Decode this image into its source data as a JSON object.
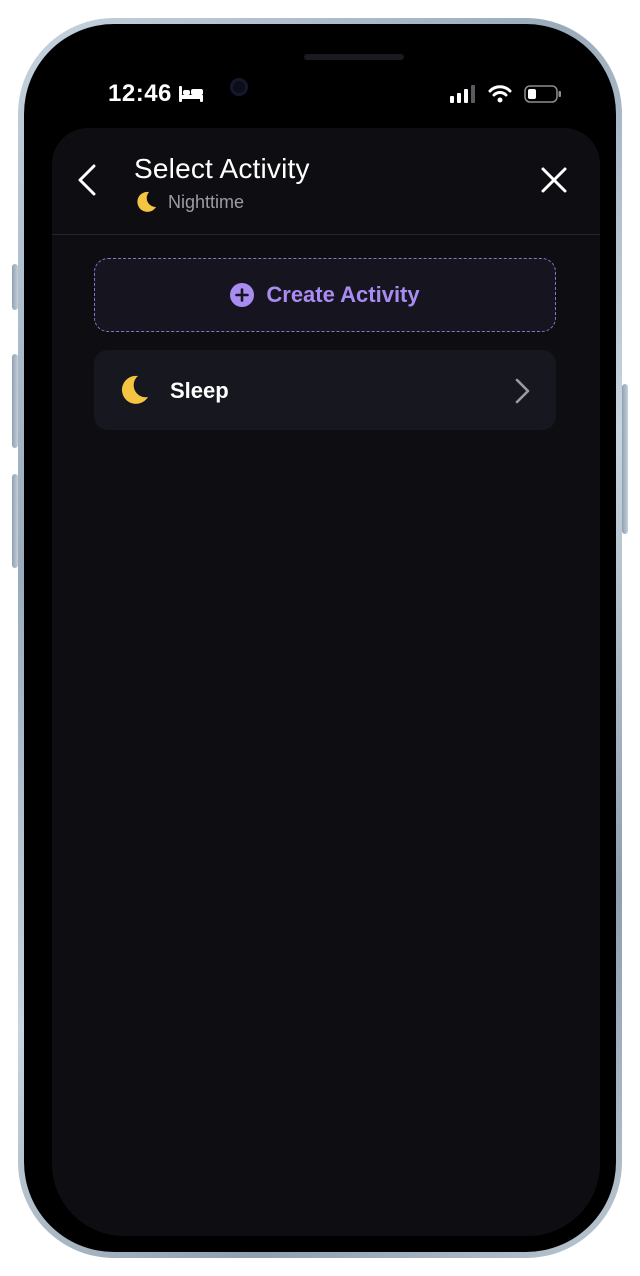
{
  "status_bar": {
    "time": "12:46",
    "mode_icon": "bed-icon",
    "cellular_icon": "signal-bars-icon",
    "wifi_icon": "wifi-icon",
    "battery_icon": "battery-icon"
  },
  "header": {
    "title": "Select Activity",
    "subtitle": "Nighttime",
    "subtitle_icon": "crescent-moon-icon",
    "back_icon": "chevron-left-icon",
    "close_icon": "close-icon"
  },
  "create_activity": {
    "label": "Create Activity",
    "icon": "plus-circle-icon",
    "accent_color": "#a98cf2"
  },
  "activities": [
    {
      "label": "Sleep",
      "icon": "crescent-moon-icon"
    }
  ],
  "colors": {
    "background": "#0e0e12",
    "card": "#17181f",
    "accent": "#a98cf2",
    "moon": "#f5c542"
  }
}
